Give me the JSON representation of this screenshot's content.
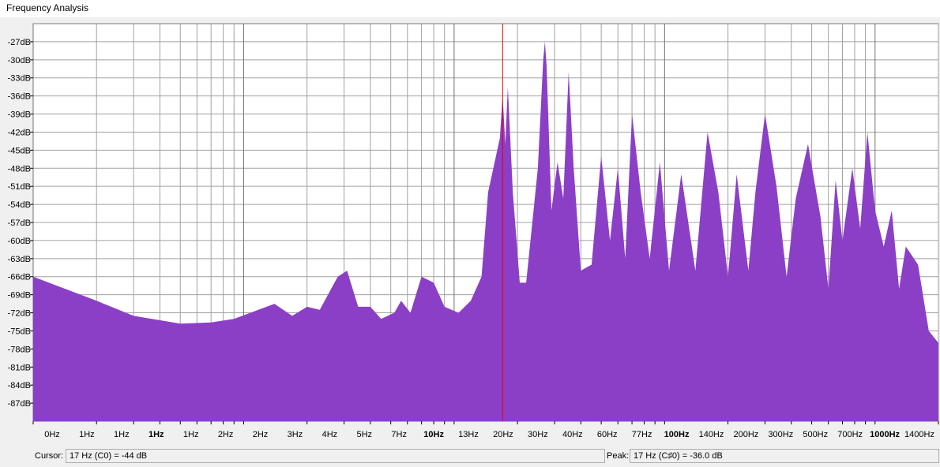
{
  "window": {
    "title": "Frequency Analysis"
  },
  "colors": {
    "spectrum": "#8b3fc6",
    "cursor": "#e60000",
    "grid": "#a0a0a0",
    "plot_bg": "#ffffff"
  },
  "status": {
    "cursor_label": "Cursor:",
    "cursor_value": "17 Hz (C0) = -44 dB",
    "peak_label": "Peak:",
    "peak_value": "17 Hz (C♯0) = -36.0 dB"
  },
  "chart_data": {
    "type": "area",
    "title": "",
    "xlabel": "",
    "ylabel": "",
    "y_ticks": [
      "-27dB",
      "-30dB",
      "-33dB",
      "-36dB",
      "-39dB",
      "-42dB",
      "-45dB",
      "-48dB",
      "-51dB",
      "-54dB",
      "-57dB",
      "-60dB",
      "-63dB",
      "-66dB",
      "-69dB",
      "-72dB",
      "-75dB",
      "-78dB",
      "-81dB",
      "-84dB",
      "-87dB"
    ],
    "x_ticks": [
      {
        "text": "0Hz",
        "bold": false
      },
      {
        "text": "1Hz",
        "bold": false
      },
      {
        "text": "1Hz",
        "bold": false
      },
      {
        "text": "1Hz",
        "bold": true
      },
      {
        "text": "1Hz",
        "bold": false
      },
      {
        "text": "2Hz",
        "bold": false
      },
      {
        "text": "2Hz",
        "bold": false
      },
      {
        "text": "3Hz",
        "bold": false
      },
      {
        "text": "4Hz",
        "bold": false
      },
      {
        "text": "5Hz",
        "bold": false
      },
      {
        "text": "7Hz",
        "bold": false
      },
      {
        "text": "10Hz",
        "bold": true
      },
      {
        "text": "13Hz",
        "bold": false
      },
      {
        "text": "20Hz",
        "bold": false
      },
      {
        "text": "30Hz",
        "bold": false
      },
      {
        "text": "40Hz",
        "bold": false
      },
      {
        "text": "60Hz",
        "bold": false
      },
      {
        "text": "77Hz",
        "bold": false
      },
      {
        "text": "100Hz",
        "bold": true
      },
      {
        "text": "140Hz",
        "bold": false
      },
      {
        "text": "200Hz",
        "bold": false
      },
      {
        "text": "300Hz",
        "bold": false
      },
      {
        "text": "500Hz",
        "bold": false
      },
      {
        "text": "700Hz",
        "bold": false
      },
      {
        "text": "1000Hz",
        "bold": true
      },
      {
        "text": "1400Hz",
        "bold": false
      }
    ],
    "grid": true,
    "log_x": true,
    "xlim_hz": [
      0.1,
      2000
    ],
    "ylim_db": [
      -90,
      -24
    ],
    "cursor_hz": 17,
    "series": [
      {
        "points": [
          [
            0.1,
            -66
          ],
          [
            0.2,
            -70
          ],
          [
            0.3,
            -72.5
          ],
          [
            0.5,
            -73.8
          ],
          [
            0.7,
            -73.6
          ],
          [
            0.9,
            -73
          ],
          [
            1.4,
            -70.5
          ],
          [
            1.7,
            -72.5
          ],
          [
            2.0,
            -71
          ],
          [
            2.3,
            -71.5
          ],
          [
            2.8,
            -66
          ],
          [
            3.1,
            -65
          ],
          [
            3.5,
            -71
          ],
          [
            4.0,
            -71
          ],
          [
            4.5,
            -73
          ],
          [
            5.2,
            -72
          ],
          [
            5.6,
            -70
          ],
          [
            6.2,
            -72
          ],
          [
            7.0,
            -66
          ],
          [
            8.0,
            -67
          ],
          [
            9.0,
            -71
          ],
          [
            10.5,
            -72
          ],
          [
            12.0,
            -70
          ],
          [
            13.5,
            -66
          ],
          [
            14.5,
            -52
          ],
          [
            16.5,
            -43
          ],
          [
            17.0,
            -36
          ],
          [
            17.5,
            -44
          ],
          [
            18.0,
            -34.5
          ],
          [
            19.0,
            -52
          ],
          [
            20.5,
            -67
          ],
          [
            22.0,
            -67
          ],
          [
            25.0,
            -48
          ],
          [
            26.5,
            -30
          ],
          [
            27.0,
            -27
          ],
          [
            27.5,
            -31
          ],
          [
            29.0,
            -55
          ],
          [
            31.0,
            -47
          ],
          [
            33.0,
            -53
          ],
          [
            35.0,
            -32
          ],
          [
            37.0,
            -48
          ],
          [
            40.0,
            -65
          ],
          [
            45.0,
            -64
          ],
          [
            50.0,
            -46
          ],
          [
            55.0,
            -60
          ],
          [
            60.0,
            -48
          ],
          [
            65.0,
            -63
          ],
          [
            70.0,
            -39
          ],
          [
            77.0,
            -52
          ],
          [
            85.0,
            -63
          ],
          [
            95.0,
            -47
          ],
          [
            105.0,
            -65
          ],
          [
            120.0,
            -49
          ],
          [
            140.0,
            -65
          ],
          [
            160.0,
            -42
          ],
          [
            180.0,
            -52
          ],
          [
            200.0,
            -66
          ],
          [
            220.0,
            -49
          ],
          [
            250.0,
            -65
          ],
          [
            270.0,
            -52
          ],
          [
            300.0,
            -39
          ],
          [
            340.0,
            -51
          ],
          [
            380.0,
            -66
          ],
          [
            420.0,
            -53
          ],
          [
            480.0,
            -44
          ],
          [
            550.0,
            -56
          ],
          [
            600.0,
            -68
          ],
          [
            650.0,
            -50
          ],
          [
            700.0,
            -60
          ],
          [
            780.0,
            -48
          ],
          [
            850.0,
            -58
          ],
          [
            920.0,
            -42
          ],
          [
            1000.0,
            -55
          ],
          [
            1100.0,
            -61
          ],
          [
            1200.0,
            -55
          ],
          [
            1300.0,
            -68
          ],
          [
            1400.0,
            -61
          ],
          [
            1600.0,
            -64
          ],
          [
            1800.0,
            -75
          ],
          [
            2000.0,
            -77
          ]
        ]
      }
    ]
  }
}
